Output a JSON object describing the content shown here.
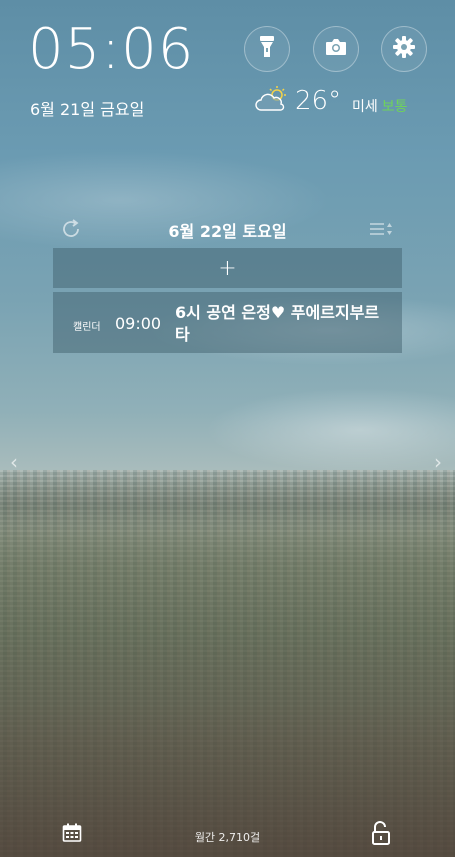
{
  "lockscreen": {
    "time": "05:06",
    "date": "6월 21일 금요일"
  },
  "quick_actions": [
    {
      "name": "flashlight-icon"
    },
    {
      "name": "camera-icon"
    },
    {
      "name": "gear-icon"
    }
  ],
  "weather": {
    "icon": "partly-cloudy-icon",
    "temperature": "26°",
    "dust_label": "미세",
    "dust_value": "보통",
    "dust_color": "#6fd35a"
  },
  "calendar_widget": {
    "date": "6월 22일 토요일",
    "add_label": "+",
    "events": [
      {
        "source": "캘린더",
        "time": "09:00",
        "title": "6시 공연 은정♥ 푸에르지부르타"
      }
    ]
  },
  "bottom_bar": {
    "text": "월간 2,710걸"
  }
}
